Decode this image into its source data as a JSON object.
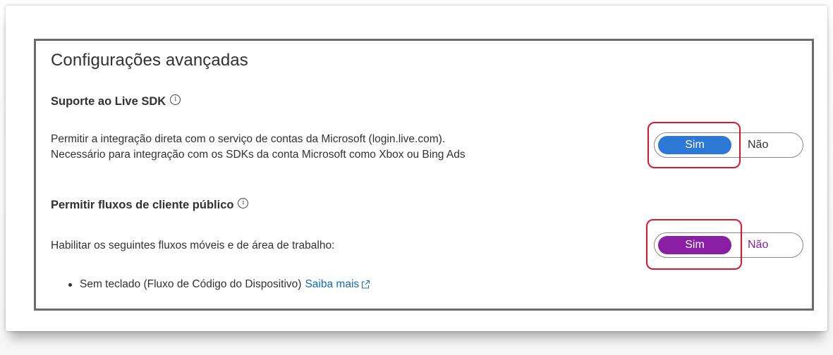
{
  "title": "Configurações avançadas",
  "live_sdk": {
    "heading": "Suporte ao Live SDK",
    "info_icon": "info-icon",
    "description_line1": "Permitir a integração direta com o serviço de contas da Microsoft (login.live.com).",
    "description_line2": "Necessário para integração com os SDKs da conta Microsoft como Xbox ou Bing Ads",
    "toggle": {
      "yes_label": "Sim",
      "no_label": "Não",
      "selected": "Sim",
      "selected_color": "#2b78d6",
      "no_color": "#323130"
    }
  },
  "public_client": {
    "heading": "Permitir fluxos de cliente público",
    "info_icon": "info-icon",
    "description": "Habilitar os seguintes fluxos móveis e de área de trabalho:",
    "toggle": {
      "yes_label": "Sim",
      "no_label": "Não",
      "selected": "Sim",
      "selected_color": "#8a1fa6",
      "no_color": "#8a1fa6"
    },
    "bullets": [
      {
        "text": "Sem teclado (Fluxo de Código do Dispositivo)",
        "link_text": "Saiba mais",
        "link_icon": "external-link-icon"
      }
    ]
  },
  "colors": {
    "highlight": "#e0142b",
    "link": "#0f6cbd",
    "panel_border": "#6b6b6b"
  }
}
